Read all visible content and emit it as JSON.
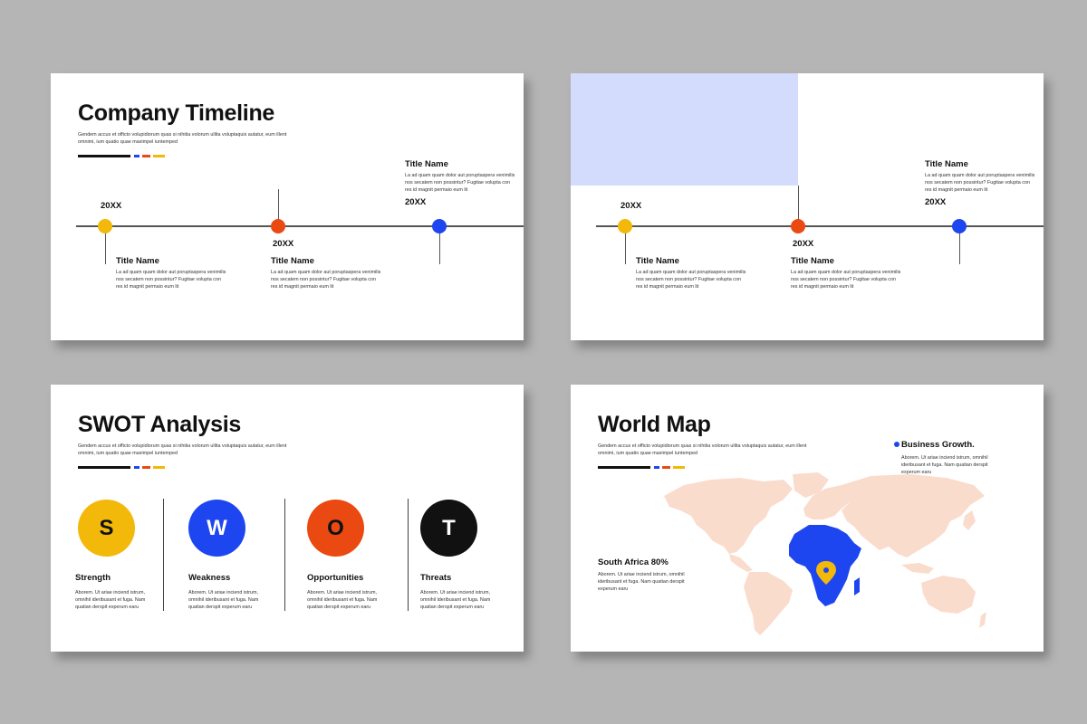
{
  "accent_colors": {
    "black": "#111111",
    "blue": "#1e46f0",
    "red": "#ea4a12",
    "yellow": "#f2b90a",
    "lavender": "#d3dcfd",
    "map": "#fadccd"
  },
  "slide1": {
    "title": "Company Timeline",
    "subtitle": "Gendem accus et officto volupidiorum quas si nihitia volorum ullita voluptaquis autatur, eum illent omnimi, ium quatio quae maximpel iuntemped",
    "items": [
      {
        "year": "20XX",
        "title": "Title Name",
        "text": "La ad quam quam dolor aut poruptaspera venimilis nos secatem non possintur? Fugitae volupta con res id magnit permaio eum lit"
      },
      {
        "year": "20XX",
        "title": "Title Name",
        "text": "La ad quam quam dolor aut poruptaspera venimilis nos secatem non possintur? Fugitae volupta con res id magnit permaio eum lit"
      },
      {
        "year": "20XX",
        "title": "Title Name",
        "text": "La ad quam quam dolor aut poruptaspera venimilis nos secatem non possintur? Fugitae volupta con res id magnit permaio eum lit"
      }
    ]
  },
  "slide2": {
    "items": [
      {
        "year": "20XX",
        "title": "Title Name",
        "text": "La ad quam quam dolor aut poruptaspera venimilis nos secatem non possintur? Fugitae volupta con res id magnit permaio eum lit"
      },
      {
        "year": "20XX",
        "title": "Title Name",
        "text": "La ad quam quam dolor aut poruptaspera venimilis nos secatem non possintur? Fugitae volupta con res id magnit permaio eum lit"
      },
      {
        "year": "20XX",
        "title": "Title Name",
        "text": "La ad quam quam dolor aut poruptaspera venimilis nos secatem non possintur? Fugitae volupta con res id magnit permaio eum lit"
      }
    ]
  },
  "slide3": {
    "title": "SWOT Analysis",
    "subtitle": "Gendem accus et officto volupidiorum quas si nihitia volorum ullita voluptaquis autatur, eum illent omnimi, ium quatio quae maximpel iuntemped",
    "items": [
      {
        "letter": "S",
        "label": "Strength",
        "text": "Aborem. Ut ariae inciend istrum, omnihil ideribusant et fuga. Nam quatian derspit experum earu",
        "color": "#f2b90a"
      },
      {
        "letter": "W",
        "label": "Weakness",
        "text": "Aborem. Ut ariae inciend istrum, omnihil ideribusant et fuga. Nam quatian derspit experum earu",
        "color": "#1e46f0"
      },
      {
        "letter": "O",
        "label": "Opportunities",
        "text": "Aborem. Ut ariae inciend istrum, omnihil ideribusant et fuga. Nam quatian derspit experum earu",
        "color": "#ea4a12"
      },
      {
        "letter": "T",
        "label": "Threats",
        "text": "Aborem. Ut ariae inciend istrum, omnihil ideribusant et fuga. Nam quatian derspit experum earu",
        "color": "#111111"
      }
    ]
  },
  "slide4": {
    "title": "World Map",
    "subtitle": "Gendem accus et officto volupidiorum quas si nihitia volorum ullita voluptaquis autatur, eum illent omnimi, ium quatio quae maximpel iuntemped",
    "highlight_title": "Business Growth.",
    "highlight_text": "Aborem. Ut ariae inciend istrum, omnihil ideribusant et fuga. Nam quatian derspit experum earu",
    "region_title": "South Africa 80%",
    "region_text": "Aborem. Ut ariae inciend istrum, omnihil ideribusant et fuga. Nam quatian derspit experum earu"
  }
}
